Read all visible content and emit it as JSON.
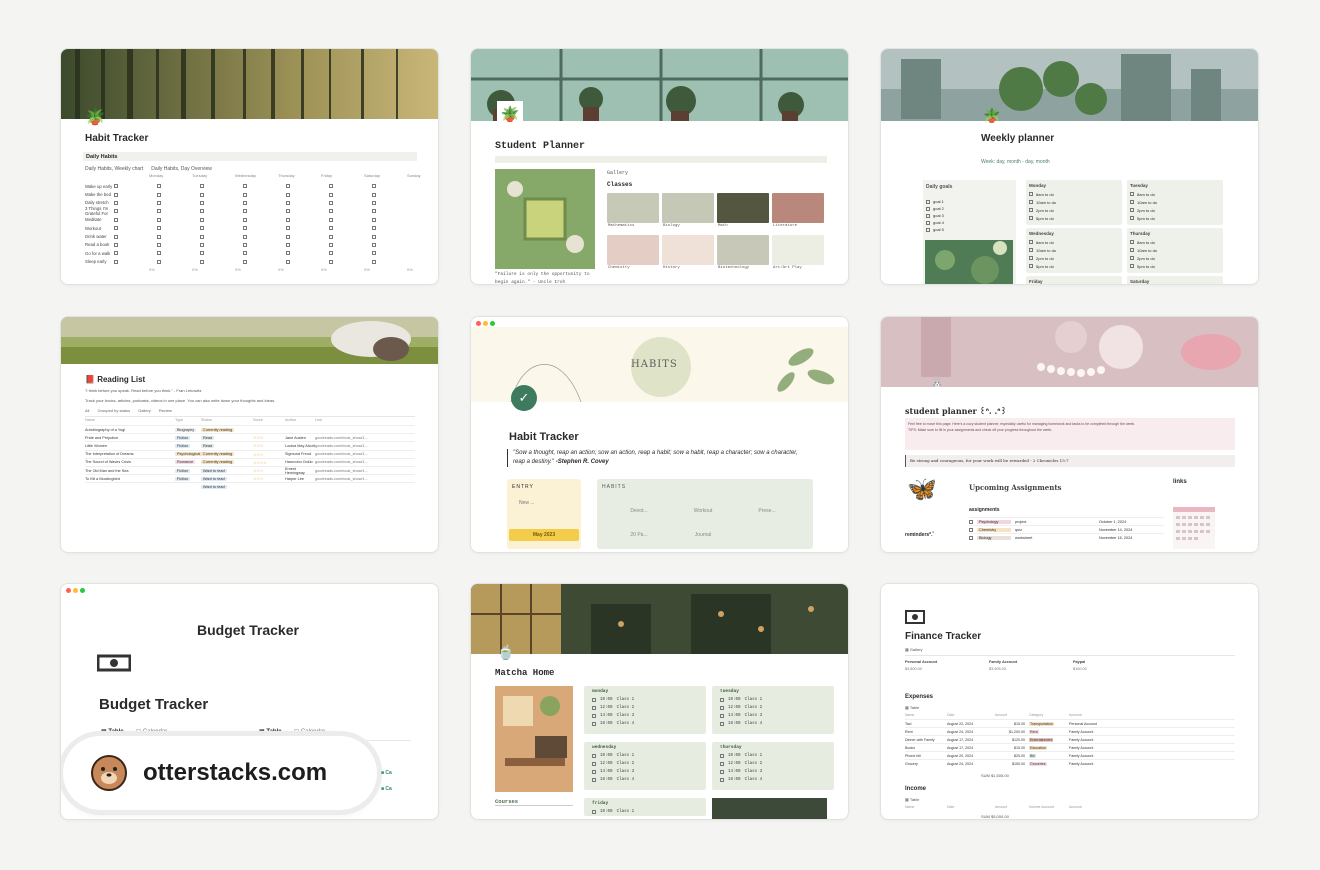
{
  "cards": {
    "habit1": {
      "title": "Habit Tracker",
      "section": "Daily Habits",
      "tabs": [
        "Daily Habits, Weekly chart",
        "Daily Habits, Day Overview"
      ],
      "days": [
        "Monday",
        "Tuesday",
        "Wednesday",
        "Thursday",
        "Friday",
        "Saturday",
        "Sunday"
      ],
      "habits": [
        "Wake up early",
        "Make the bed",
        "Daily stretch",
        "3 Things I'm Grateful For",
        "Meditate",
        "Workout",
        "Drink water",
        "Read a book",
        "Go for a walk",
        "Sleep early"
      ],
      "percent": "0%"
    },
    "student": {
      "title": "Student Planner",
      "gallery_label": "Gallery",
      "classes_label": "Classes",
      "quote": "\"Failure is only the opportunity to begin again.\" - Uncle Iroh",
      "classes": [
        "Mathematics",
        "Biology",
        "Math",
        "Literature",
        "Chemistry",
        "History",
        "Biotechnology",
        "Art/Art Play"
      ],
      "colors": [
        "#c7c9b7",
        "#c5c8b6",
        "#55563f",
        "#b9877b",
        "#e3cdc5",
        "#efe1d8",
        "#c7c8b8",
        "#eceee3"
      ]
    },
    "weekly": {
      "title": "Weekly planner",
      "subtitle": "Week: day, month - day, month",
      "goals_label": "Daily goals",
      "goals": [
        "goal 1",
        "goal 2",
        "goal 3",
        "goal 4",
        "goal 5"
      ],
      "days": [
        "Monday",
        "Tuesday",
        "Wednesday",
        "Thursday",
        "Friday",
        "Saturday"
      ],
      "tasks": [
        "8am to do",
        "10am to do",
        "2pm to do",
        "5pm to do"
      ]
    },
    "reading": {
      "title": "Reading List",
      "quote": "\"I think before you speak. Read before you think.\" - Fran Lebowitz",
      "desc": "Track your books, articles, podcasts, videos in one place. You can also write down your thoughts and ideas.",
      "views": [
        "All",
        "Grouped by status",
        "Gallery",
        "Review"
      ],
      "columns": [
        "Name",
        "Type",
        "Status",
        "Score",
        "Author",
        "Link"
      ],
      "rows": [
        {
          "name": "Autobiography of a Yogi",
          "type": "Biography",
          "status": "Currently reading",
          "score": "",
          "author": "",
          "link": ""
        },
        {
          "name": "Pride and Prejudice",
          "type": "Fiction",
          "status": "Read",
          "score": "☆☆☆",
          "author": "Jane Austen",
          "link": "goodreads.com/book_show/1..."
        },
        {
          "name": "Little Women",
          "type": "Fiction",
          "status": "Read",
          "score": "☆☆☆",
          "author": "Louisa May Alcott",
          "link": "goodreads.com/book_show/1..."
        },
        {
          "name": "The Interpretation of Dreams",
          "type": "Psychological",
          "status": "Currently reading",
          "score": "☆☆☆",
          "author": "Sigmund Freud",
          "link": "goodreads.com/book_show/1..."
        },
        {
          "name": "The Sound of Waves Crisis",
          "type": "Romance",
          "status": "Currently reading",
          "score": "☆☆☆☆",
          "author": "Harunobu Ookio",
          "link": "goodreads.com/book_show/1..."
        },
        {
          "name": "The Old Man and the Sea",
          "type": "Fiction",
          "status": "Want to read",
          "score": "☆☆☆",
          "author": "Ernest Hemingway",
          "link": "goodreads.com/book_show/1..."
        },
        {
          "name": "To Kill a Mockingbird",
          "type": "Fiction",
          "status": "Want to read",
          "score": "☆☆☆",
          "author": "Harper Lee",
          "link": "goodreads.com/book_show/1..."
        },
        {
          "name": "",
          "type": "",
          "status": "Want to read",
          "score": "",
          "author": "",
          "link": ""
        }
      ]
    },
    "habit2": {
      "title": "Habit Tracker",
      "banner_text": "HABITS",
      "quote": "\"Sow a thought, reap an action; sow an action, reap a habit; sow a habit, reap a character; sow a character, reap a destiny.\"",
      "quote_author": "-Stephen R. Covey",
      "entry_label": "ENTRY",
      "new_label": "New ...",
      "month": "May 2023",
      "habits_label": "HABITS",
      "habit_items": [
        "Devot...",
        "Workout",
        "Prese...",
        "20 Pa...",
        "Journal"
      ]
    },
    "student2": {
      "title": "student planner ꒰ᐢ. .ᐢ꒱",
      "note1": "Feel free to move this page. Here's a cozy student planner, especially useful for managing homework and tasks to be completed through the week.",
      "note2": "TIPS: Make sure to fill in your assignments and check off your progress throughout the week.",
      "verse": "Be strong and courageous, for your work will be rewarded - 2 Chronicles 15:7",
      "upcoming": "Upcoming Assignments",
      "assignments_label": "assignments",
      "links_label": "links",
      "reminders": "reminders*.ﾟ",
      "assign_rows": [
        {
          "subject": "Psychology",
          "task": "project",
          "date": "October 1, 2024"
        },
        {
          "subject": "Chemistry",
          "task": "quiz",
          "date": "November 14, 2024"
        },
        {
          "subject": "Biology",
          "task": "worksheet",
          "date": "November 15, 2024"
        }
      ]
    },
    "budget": {
      "page_title": "Budget Tracker",
      "title": "Budget Tracker",
      "tab_table": "Table",
      "tab_calendar": "Calendar",
      "watermark": "otterstacks.com"
    },
    "matcha": {
      "title": "Matcha Home",
      "courses": "Courses",
      "days": [
        "monday",
        "tuesday",
        "wednesday",
        "thursday",
        "friday"
      ],
      "slots": [
        {
          "time": "10:00",
          "cls": "Class 1"
        },
        {
          "time": "12:00",
          "cls": "Class 2"
        },
        {
          "time": "14:00",
          "cls": "Class 3"
        },
        {
          "time": "16:00",
          "cls": "Class 4"
        }
      ]
    },
    "finance": {
      "title": "Finance Tracker",
      "view": "Gallery",
      "accounts": [
        {
          "name": "Personal Account",
          "amount": "$3,800.00"
        },
        {
          "name": "Family Account",
          "amount": "$3,905.00"
        },
        {
          "name": "Paypal",
          "amount": "$100.00"
        }
      ],
      "expenses_label": "Expenses",
      "income_label": "Income",
      "table_label": "Table",
      "columns": [
        "Name",
        "Date",
        "Amount",
        "Category",
        "Account"
      ],
      "expenses": [
        {
          "name": "Taxi",
          "date": "August 22, 2024",
          "amount": "$15.00",
          "category": "Transportation",
          "account": "Personal Account"
        },
        {
          "name": "Rent",
          "date": "August 24, 2024",
          "amount": "$1,200.00",
          "category": "Rent",
          "account": "Family Account"
        },
        {
          "name": "Dinner with Family",
          "date": "August 17, 2024",
          "amount": "$120.00",
          "category": "Entertainment",
          "account": "Family Account"
        },
        {
          "name": "Books",
          "date": "August 17, 2024",
          "amount": "$15.00",
          "category": "Education",
          "account": "Family Account"
        },
        {
          "name": "Phone bill",
          "date": "August 20, 2024",
          "amount": "$25.00",
          "category": "Bill",
          "account": "Family Account"
        },
        {
          "name": "Grocery",
          "date": "August 24, 2024",
          "amount": "$150.00",
          "category": "Groceries",
          "account": "Family Account"
        }
      ],
      "expense_sum": "$1,505.00",
      "income_sum": "$5,000.00",
      "income_cols": [
        "Name",
        "Date",
        "Amount",
        "Income Account",
        "Account"
      ]
    }
  }
}
